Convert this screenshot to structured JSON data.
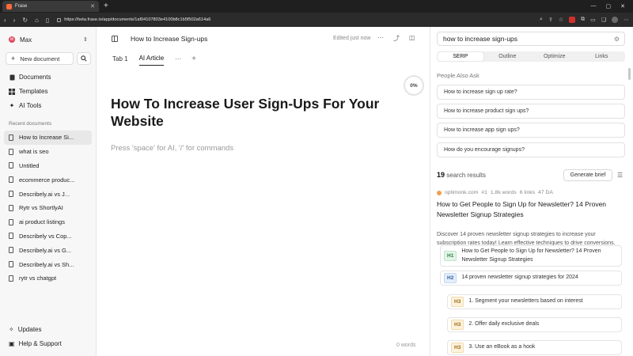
{
  "browser": {
    "tab_title": "Frase",
    "url": "https://beta.frase.io/app/documents/1af04107803e4100b8c1b5f502a614a6"
  },
  "sidebar": {
    "workspace_name": "Max",
    "workspace_initial": "M",
    "new_document_label": "New document",
    "nav": [
      {
        "label": "Documents",
        "icon": "document-icon"
      },
      {
        "label": "Templates",
        "icon": "grid-icon"
      },
      {
        "label": "AI Tools",
        "icon": "sparkle-icon"
      }
    ],
    "recent_header": "Recent documents",
    "recent": [
      "How to Increase Si...",
      "what is seo",
      "Untitled",
      "ecommerce produc...",
      "Describely.ai vs J...",
      "Rytr vs ShortlyAI",
      "ai product listings",
      "Describely vs Cop...",
      "Describely.ai vs G...",
      "Describely.ai vs Sh...",
      "rytr vs chatgpt"
    ],
    "updates_label": "Updates",
    "help_label": "Help & Support"
  },
  "editor": {
    "doc_title": "How to Increase Sign-ups",
    "edited_status": "Edited just now",
    "tabs": [
      "Tab 1",
      "AI Article"
    ],
    "progress": "0%",
    "heading": "How To Increase User Sign-Ups For Your Website",
    "placeholder": "Press 'space' for AI, '/' for commands",
    "word_count": "0 words"
  },
  "panel": {
    "query": "how to increase sign-ups",
    "segments": [
      "SERP",
      "Outline",
      "Optimize",
      "Links"
    ],
    "paa_header": "People Also Ask",
    "paa": [
      "How to increase sign up rate?",
      "How to increase product sign ups?",
      "How to increase app sign ups?",
      "How do you encourage signups?"
    ],
    "result_count": "19",
    "result_count_label": "search results",
    "generate_brief_label": "Generate brief",
    "result": {
      "domain": "optimonk.com",
      "rank": "#1",
      "words": "1.8k words",
      "links": "6 links",
      "da": "47 DA",
      "title": "How to Get People to Sign Up for Newsletter? 14 Proven Newsletter Signup Strategies",
      "description": "Discover 14 proven newsletter signup strategies to increase your subscription rates today! Learn effective techniques to drive conversions.",
      "headings": [
        {
          "tag": "H1",
          "text": "How to Get People to Sign Up for Newsletter? 14 Proven Newsletter Signup Strategies"
        },
        {
          "tag": "H2",
          "text": "14 proven newsletter signup strategies for 2024"
        },
        {
          "tag": "H3",
          "text": "1. Segment your newsletters based on interest"
        },
        {
          "tag": "H3",
          "text": "2. Offer daily exclusive deals"
        },
        {
          "tag": "H3",
          "text": "3. Use an eBook as a hook"
        }
      ]
    }
  },
  "colors": {
    "accent_avatar": "#e0465e",
    "h1_tag": "#2d7a45",
    "h2_tag": "#2d5c9c",
    "h3_tag": "#9a6a13"
  }
}
